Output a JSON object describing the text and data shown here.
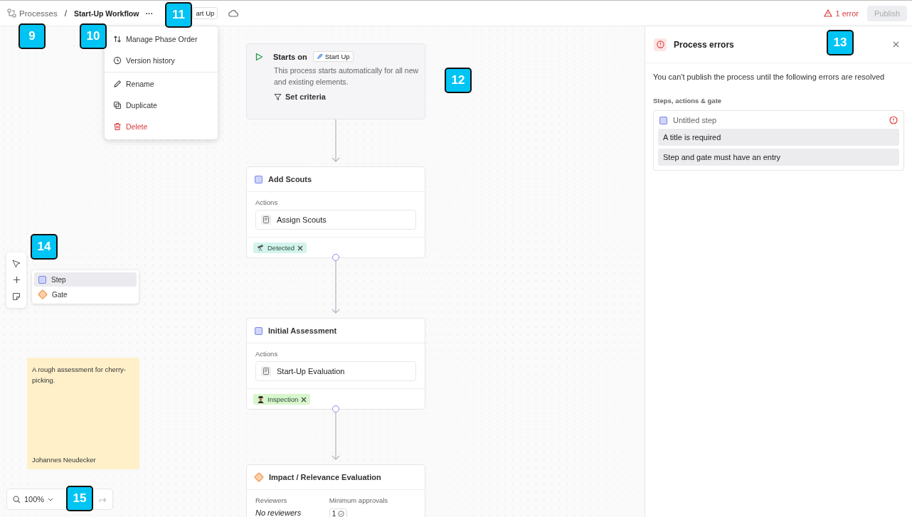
{
  "breadcrumb": {
    "parent": "Processes",
    "separator": "/",
    "title": "Start-Up Workflow",
    "more": "···",
    "trigger_chip": "art Up"
  },
  "errors_indicator": {
    "label": "1 error"
  },
  "publish_button": {
    "label": "Publish",
    "disabled": true
  },
  "menu": {
    "sections": [
      [
        {
          "label": "Manage Phase Order",
          "kind": "sort",
          "danger": false
        },
        {
          "label": "Version history",
          "kind": "history",
          "danger": false
        }
      ],
      [
        {
          "label": "Rename",
          "kind": "rename",
          "danger": false
        },
        {
          "label": "Duplicate",
          "kind": "duplicate",
          "danger": false
        },
        {
          "label": "Delete",
          "kind": "delete",
          "danger": true
        }
      ]
    ]
  },
  "canvas": {
    "trigger": {
      "label": "Starts on",
      "chip": "Start Up",
      "description": "This process starts automatically for all new and existing elements.",
      "criteria": "Set criteria"
    },
    "nodes": [
      {
        "kind": "step",
        "title": "Add Scouts",
        "actions_label": "Actions",
        "actions": [
          "Assign Scouts"
        ],
        "tag": {
          "label": "Detected",
          "kind": "telescope",
          "color": "#d3f4ec"
        }
      },
      {
        "kind": "step",
        "title": "Initial Assessment",
        "actions_label": "Actions",
        "actions": [
          "Start-Up Evaluation"
        ],
        "tag": {
          "label": "Inspection",
          "kind": "detective",
          "color": "#d8f6cc"
        }
      },
      {
        "kind": "gate",
        "title": "Impact / Relevance Evaluation",
        "reviewers_label": "Reviewers",
        "reviewers": "No reviewers",
        "approvals_label": "Minimum approvals",
        "approvals": "1"
      }
    ],
    "add_menu": {
      "items": [
        {
          "label": "Step",
          "kind": "step",
          "selected": true
        },
        {
          "label": "Gate",
          "kind": "gate",
          "selected": false
        }
      ]
    },
    "sticky_note": {
      "text": "A rough assessment for cherry-picking.",
      "author": "Johannes Neudecker"
    },
    "zoom": {
      "value": "100%"
    }
  },
  "error_panel": {
    "title": "Process errors",
    "message": "You can't publish the process until the following errors are resolved",
    "section": "Steps, actions & gate",
    "groups": [
      {
        "kind": "step",
        "name": "Untitled step",
        "errors": [
          "A title is required",
          "Step and gate must have an entry"
        ]
      }
    ]
  },
  "callouts": [
    "9",
    "10",
    "11",
    "12",
    "13",
    "14",
    "15"
  ]
}
